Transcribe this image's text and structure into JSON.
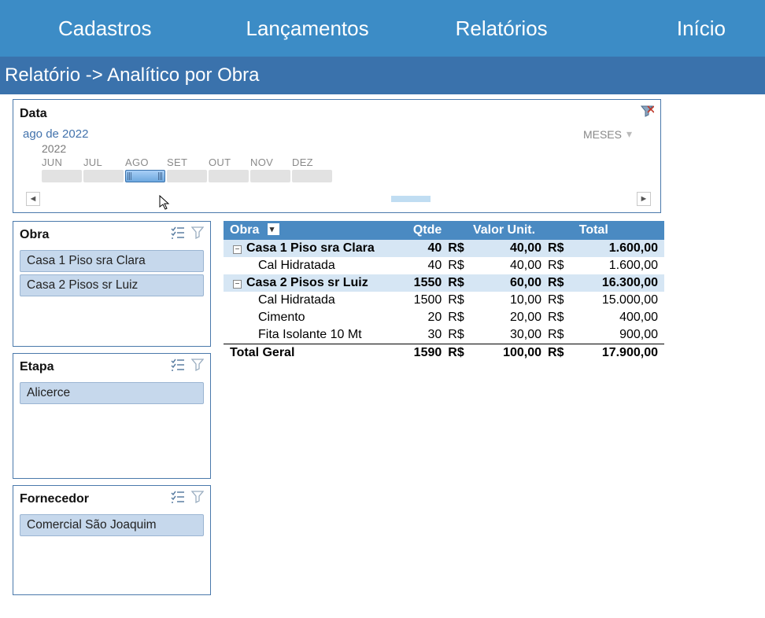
{
  "nav": {
    "tabs": [
      "Cadastros",
      "Lançamentos",
      "Relatórios",
      "Início"
    ]
  },
  "subheader": "Relatório -> Analítico por Obra",
  "timeline": {
    "title": "Data",
    "selected_label": "ago de 2022",
    "period_label": "MESES",
    "year": "2022",
    "months": [
      "JUN",
      "JUL",
      "AGO",
      "SET",
      "OUT",
      "NOV",
      "DEZ"
    ],
    "selected_index": 2
  },
  "slicers": {
    "obra": {
      "title": "Obra",
      "items": [
        "Casa 1 Piso sra Clara",
        "Casa 2 Pisos sr Luiz"
      ]
    },
    "etapa": {
      "title": "Etapa",
      "items": [
        "Alicerce"
      ]
    },
    "forn": {
      "title": "Fornecedor",
      "items": [
        "Comercial São Joaquim"
      ]
    }
  },
  "grid": {
    "cols": {
      "obra": "Obra",
      "qtde": "Qtde",
      "vu": "Valor Unit.",
      "tot": "Total"
    },
    "currency": "R$",
    "groups": [
      {
        "name": "Casa 1 Piso sra Clara",
        "qtde": "40",
        "unit": "40,00",
        "total": "1.600,00",
        "rows": [
          {
            "name": "Cal Hidratada",
            "qtde": "40",
            "unit": "40,00",
            "total": "1.600,00"
          }
        ]
      },
      {
        "name": "Casa 2 Pisos sr Luiz",
        "qtde": "1550",
        "unit": "60,00",
        "total": "16.300,00",
        "rows": [
          {
            "name": "Cal Hidratada",
            "qtde": "1500",
            "unit": "10,00",
            "total": "15.000,00"
          },
          {
            "name": "Cimento",
            "qtde": "20",
            "unit": "20,00",
            "total": "400,00"
          },
          {
            "name": "Fita Isolante 10 Mt",
            "qtde": "30",
            "unit": "30,00",
            "total": "900,00"
          }
        ]
      }
    ],
    "grand": {
      "label": "Total Geral",
      "qtde": "1590",
      "unit": "100,00",
      "total": "17.900,00"
    }
  },
  "icons": {
    "multi": "multi-select-icon",
    "funnel": "clear-filter-icon",
    "filterx": "clear-timeline-filter-icon"
  }
}
